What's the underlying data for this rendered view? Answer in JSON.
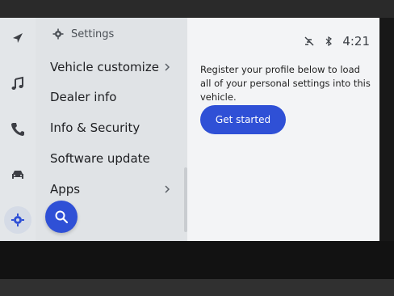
{
  "sidebar": {
    "items": [
      {
        "icon": "navigation-arrow-icon"
      },
      {
        "icon": "music-note-icon"
      },
      {
        "icon": "phone-icon"
      },
      {
        "icon": "car-icon"
      },
      {
        "icon": "settings-gear-icon",
        "active": true
      }
    ]
  },
  "menu": {
    "header": "Settings",
    "items": [
      {
        "label": "Vehicle customize",
        "chevron": true
      },
      {
        "label": "Dealer info"
      },
      {
        "label": "Info & Security"
      },
      {
        "label": "Software update"
      },
      {
        "label": "Apps",
        "chevron": true
      }
    ]
  },
  "status": {
    "time": "4:21",
    "icons": [
      "no-signal-icon",
      "bluetooth-icon"
    ]
  },
  "main": {
    "prompt": "Register your profile below to load all of your personal settings into this vehicle.",
    "cta_label": "Get started"
  },
  "colors": {
    "accent": "#2f50d6",
    "screen_bg": "#e9ecef",
    "menu_bg": "#e0e3e6"
  }
}
